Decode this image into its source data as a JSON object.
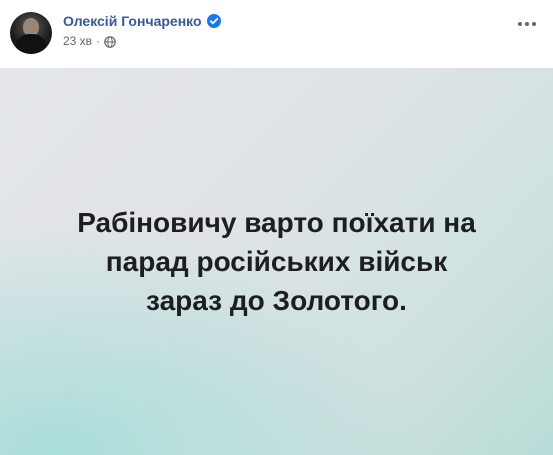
{
  "post": {
    "author": {
      "name": "Олексій Гончаренко",
      "verified_icon": "verified-badge-icon",
      "avatar_icon": "avatar"
    },
    "meta": {
      "time": "23 хв",
      "separator": "·",
      "audience_icon": "globe-icon"
    },
    "more_icon": "more-options-icon",
    "card": {
      "text": "Рабіновичу варто поїхати на\nпарад російських військ\nзараз до Золотого."
    }
  },
  "colors": {
    "author_name": "#385898",
    "meta_text": "#606770",
    "verified_badge": "#1877f2",
    "post_text": "#1c1e21",
    "card_gradient_gray": "#e4e6ea",
    "card_gradient_teal": "#a9ded9"
  }
}
